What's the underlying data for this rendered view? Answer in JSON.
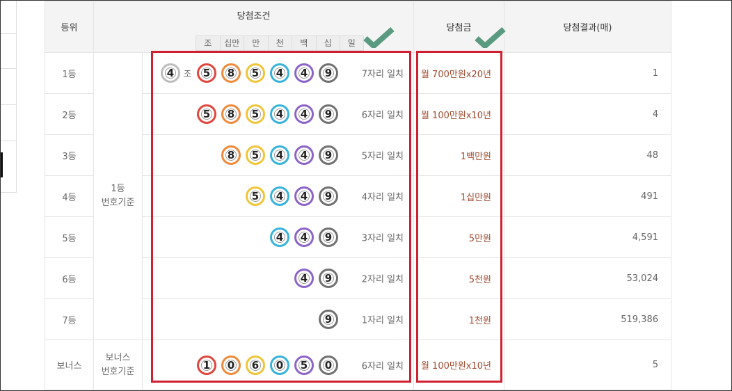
{
  "headers": {
    "rank": "등위",
    "condition": "당첨조건",
    "prize": "당첨금",
    "result": "당첨결과(매)"
  },
  "digit_places": [
    "조",
    "십만",
    "만",
    "천",
    "백",
    "십",
    "일"
  ],
  "jo_label": "조",
  "rows": [
    {
      "rank": "1등",
      "balls": [
        "5",
        "8",
        "5",
        "4",
        "4",
        "9"
      ],
      "group_digit": "4",
      "match": "7자리 일치",
      "prize": "월 700만원x20년",
      "count": "1"
    },
    {
      "rank": "2등",
      "balls": [
        "5",
        "8",
        "5",
        "4",
        "4",
        "9"
      ],
      "match": "6자리 일치",
      "prize": "월 100만원x10년",
      "count": "4"
    },
    {
      "rank": "3등",
      "balls": [
        "8",
        "5",
        "4",
        "4",
        "9"
      ],
      "match": "5자리 일치",
      "prize": "1백만원",
      "count": "48"
    },
    {
      "rank": "4등",
      "balls": [
        "5",
        "4",
        "4",
        "9"
      ],
      "match": "4자리 일치",
      "prize": "1십만원",
      "count": "491"
    },
    {
      "rank": "5등",
      "balls": [
        "4",
        "4",
        "9"
      ],
      "match": "3자리 일치",
      "prize": "5만원",
      "count": "4,591"
    },
    {
      "rank": "6등",
      "balls": [
        "4",
        "9"
      ],
      "match": "2자리 일치",
      "prize": "5천원",
      "count": "53,024"
    },
    {
      "rank": "7등",
      "balls": [
        "9"
      ],
      "match": "1자리 일치",
      "prize": "1천원",
      "count": "519,386"
    },
    {
      "rank": "보너스",
      "balls": [
        "1",
        "0",
        "6",
        "0",
        "5",
        "0"
      ],
      "match": "6자리 일치",
      "prize": "월 100만원x10년",
      "count": "5"
    }
  ],
  "criteria": {
    "first": {
      "line1": "1등",
      "line2": "번호기준"
    },
    "bonus": {
      "line1": "보너스",
      "line2": "번호기준"
    }
  },
  "colors": {
    "place_rings": [
      "#e0453e",
      "#ee8a3a",
      "#f0c537",
      "#36b3d9",
      "#8c63c9",
      "#707070"
    ],
    "group_ring": "#bdbdbd",
    "highlight": "#d0202f",
    "check": "#5a9a80",
    "prize_text": "#a04a2f"
  }
}
